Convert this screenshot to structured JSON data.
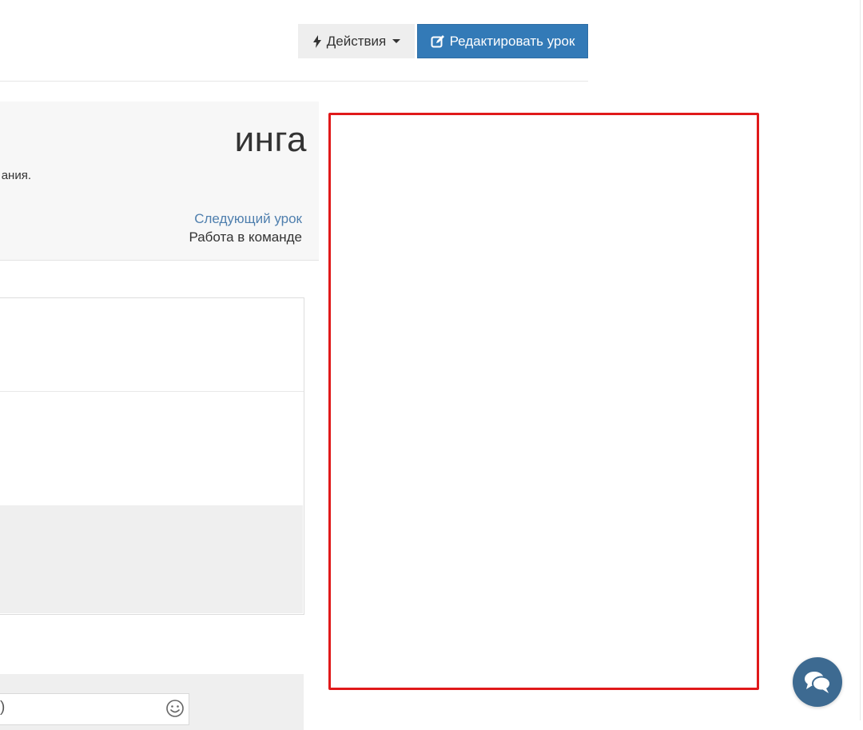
{
  "toolbar": {
    "actions_label": "Действия",
    "edit_label": "Редактировать урок"
  },
  "lesson": {
    "title_fragment": "инга",
    "description_fragment": "ания."
  },
  "next_lesson": {
    "label": "Следующий урок",
    "title": "Работа в команде"
  },
  "comment": {
    "text_fragment": ")"
  },
  "colors": {
    "primary": "#337ab7",
    "highlight": "#e0191a",
    "chat": "#3d6a91",
    "link": "#4f7fae"
  },
  "icons": {
    "actions": "lightning-bolt-icon",
    "edit": "edit-square-icon",
    "emoji": "smiley-icon",
    "chat": "chat-bubbles-icon"
  }
}
